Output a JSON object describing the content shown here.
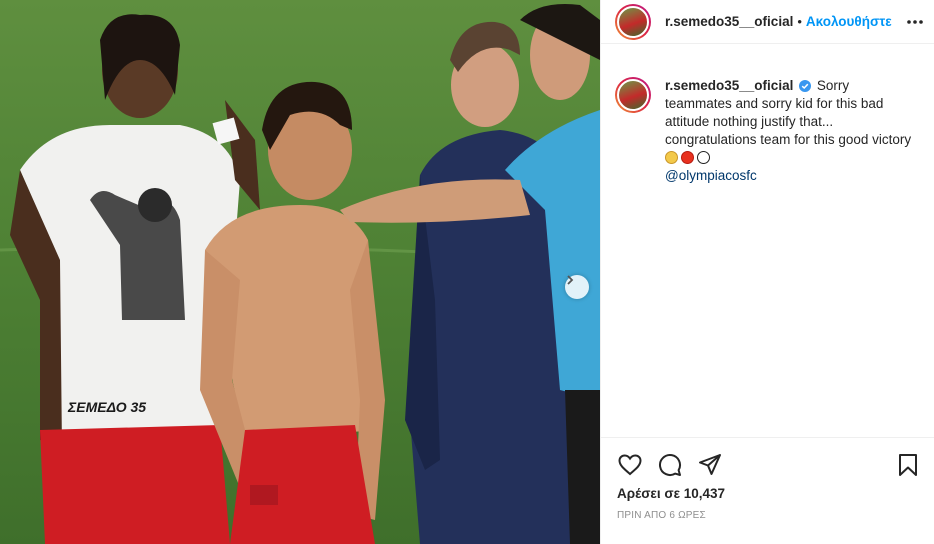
{
  "post": {
    "photo_alt": "Footballers and a referee on the pitch after a match",
    "username": "r.semedo35__oficial",
    "separator": "•",
    "follow_label": "Ακολουθήστε",
    "caption": {
      "username": "r.semedo35__oficial",
      "text": "Sorry teammates and sorry kid for this bad attitude nothing justify that... congratulations team for this good victory",
      "mention": "@olympiacosfc",
      "emojis": [
        "disappointed-face",
        "red-circle",
        "white-circle"
      ]
    },
    "shirt_text": "ΣΕΜΕΔΟ 35",
    "likes_label": "Αρέσει σε 10,437",
    "time_label": "ΠΡΙΝ ΑΠΟ 6 ΩΡΕΣ"
  },
  "colors": {
    "accent": "#0095f6",
    "mention": "#00376b",
    "text": "#262626",
    "muted": "#8e8e8e"
  }
}
